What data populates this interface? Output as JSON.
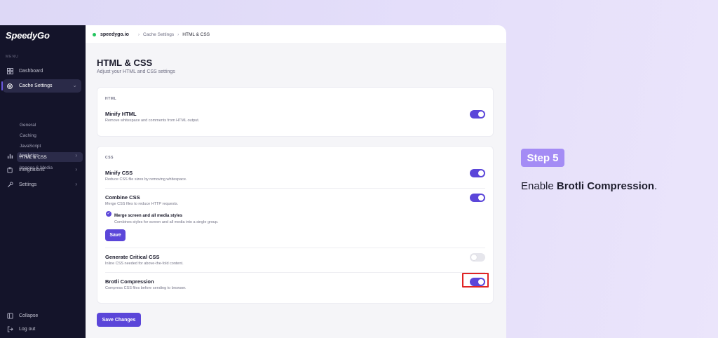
{
  "app": {
    "logo": "SpeedyGo",
    "menu_label": "MENU",
    "nav": {
      "dashboard": "Dashboard",
      "cache_settings": "Cache Settings",
      "sub": [
        "General",
        "Caching",
        "JavaScript",
        "HTML & CSS",
        "Images & Media"
      ],
      "analytics": "Analytics",
      "integrations": "Integrations",
      "settings": "Settings",
      "collapse": "Collapse",
      "logout": "Log out"
    },
    "topbar": {
      "site": "speedygo.io",
      "crumbs": [
        "Cache Settings",
        "HTML & CSS"
      ],
      "status_color": "#22c55e"
    },
    "page": {
      "title": "HTML & CSS",
      "subtitle": "Adjust your HTML and CSS settings"
    },
    "html_card": {
      "label": "HTML",
      "minify_html": {
        "title": "Minify HTML",
        "desc": "Remove whitespace and comments from HTML output.",
        "enabled": true
      }
    },
    "css_card": {
      "label": "CSS",
      "minify_css": {
        "title": "Minify CSS",
        "desc": "Reduce CSS file sizes by removing whitespace.",
        "enabled": true
      },
      "combine_css": {
        "title": "Combine CSS",
        "desc": "Merge CSS files to reduce HTTP requests.",
        "enabled": true,
        "option_title": "Merge screen and all media styles",
        "option_desc": "Combines styles for screen and all media into a single group.",
        "option_checked": true,
        "save_label": "Save"
      },
      "critical_css": {
        "title": "Generate Critical CSS",
        "desc": "Inline CSS needed for above-the-fold content.",
        "enabled": false
      },
      "brotli": {
        "title": "Brotli Compression",
        "desc": "Compress CSS files before sending to browser.",
        "enabled": true
      }
    },
    "save_changes_label": "Save Changes",
    "accent_color": "#5b46d9"
  },
  "annotation": {
    "step": "Step 5",
    "text_prefix": "Enable ",
    "text_bold": "Brotli Compression",
    "text_suffix": ".",
    "highlight_color": "#e02424"
  }
}
